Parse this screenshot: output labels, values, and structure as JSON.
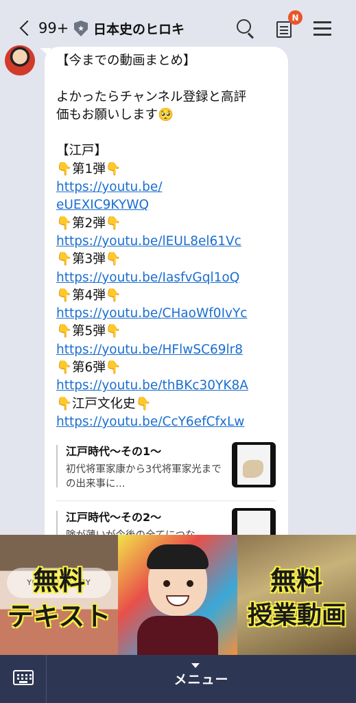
{
  "header": {
    "back_count": "99+",
    "title": "日本史のヒロキ",
    "notification_badge": "N"
  },
  "message": {
    "lines": [
      "【今までの動画まとめ】",
      "",
      "よかったらチャンネル登録と高評",
      "価もお願いします🥺",
      "",
      "【江戸】"
    ],
    "videos": [
      {
        "label": "第1弾",
        "url_line1": "https://youtu.be/",
        "url_line2": "eUEXIC9KYWQ"
      },
      {
        "label": "第2弾",
        "url": "https://youtu.be/lEUL8el61Vc"
      },
      {
        "label": "第3弾",
        "url": "https://youtu.be/IasfvGql1oQ"
      },
      {
        "label": "第4弾",
        "url": "https://youtu.be/CHaoWf0IvYc"
      },
      {
        "label": "第5弾",
        "url": "https://youtu.be/HFlwSC69lr8"
      },
      {
        "label": "第6弾",
        "url": "https://youtu.be/thBKc30YK8A"
      },
      {
        "label": "江戸文化史",
        "url": "https://youtu.be/CcY6efCfxLw"
      }
    ],
    "hand_emoji": "👇"
  },
  "link_cards": [
    {
      "title": "江戸時代〜その1〜",
      "desc": "初代将軍家康から3代将軍家光までの出来事に..."
    },
    {
      "title": "江戸時代〜その2〜",
      "desc": "険が薄いが今後の全てにつな"
    }
  ],
  "rich_menu": {
    "left": {
      "line1": "無料",
      "line2": "テキスト",
      "banner": "YOUR HISTORY"
    },
    "right": {
      "line1": "無料",
      "line2": "授業動画"
    }
  },
  "bottom_bar": {
    "menu_label": "メニュー"
  }
}
